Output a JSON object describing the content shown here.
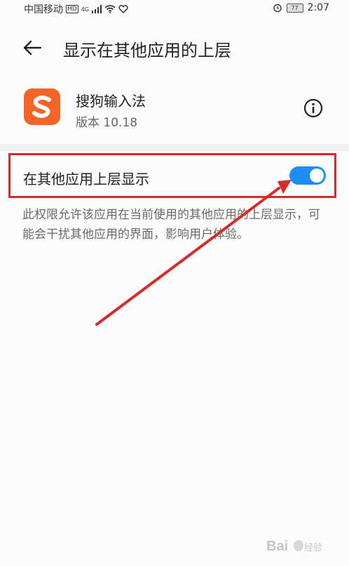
{
  "status_bar": {
    "carrier": "中国移动",
    "hd": "HD",
    "network": "4G",
    "battery": "77",
    "time": "2:07"
  },
  "header": {
    "title": "显示在其他应用的上层"
  },
  "app": {
    "name": "搜狗输入法",
    "version": "版本 10.18",
    "icon_letter": "S"
  },
  "setting": {
    "label": "在其他应用上层显示",
    "enabled": true
  },
  "description": "此权限允许该应用在当前使用的其他应用的上层显示，可能会干扰其他应用的界面，影响用户体验。",
  "colors": {
    "toggle_on": "#1e8ef7",
    "annotation_red": "#d42b2b",
    "app_icon": "#f26524"
  }
}
